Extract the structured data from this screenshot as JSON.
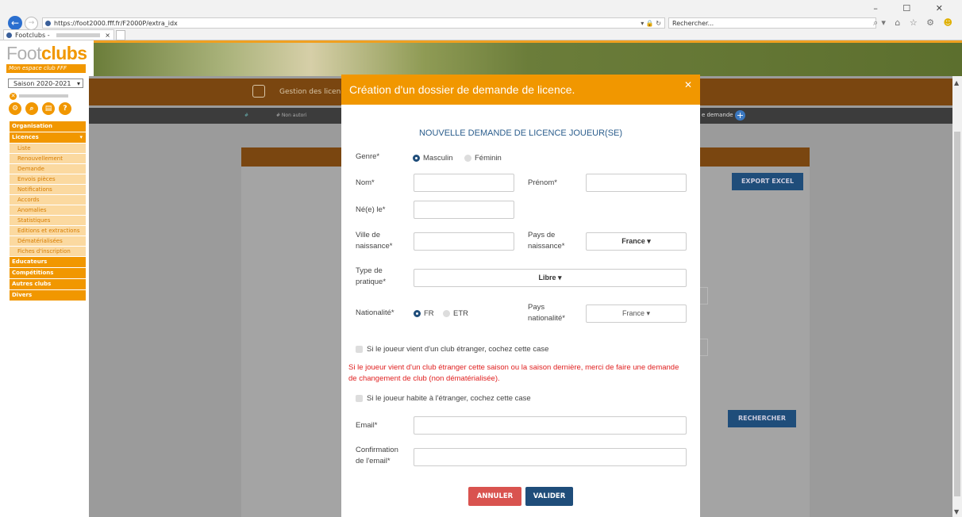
{
  "browser": {
    "url": "https://foot2000.fff.fr/F2000P/extra_idx",
    "search_placeholder": "Rechercher...",
    "tab_title": "Footclubs -",
    "window_controls": "– ☐ ✕"
  },
  "site": {
    "logo_foot": "Foot",
    "logo_clubs": "clubs",
    "logo_sub": "Mon espace club FFF"
  },
  "sidebar": {
    "season": "Saison 2020-2021",
    "menu": [
      {
        "label": "Organisation"
      },
      {
        "label": "Licences"
      }
    ],
    "licences_sub": [
      "Liste",
      "Renouvellement",
      "Demande",
      "Envois pièces",
      "Notifications",
      "Accords",
      "Anomalies",
      "Statistiques",
      "Editions et extractions",
      "Dématérialisées",
      "Fiches d'inscription"
    ],
    "menu_after": [
      "Educateurs",
      "Compétitions",
      "Autres clubs",
      "Divers"
    ]
  },
  "main": {
    "title": "Gestion des licen",
    "nav_item": "# Non autori",
    "nav_right": "e demande",
    "export_label": "EXPORT EXCEL",
    "search_label": "RECHERCHER"
  },
  "modal": {
    "title": "Création d'un dossier de demande de licence.",
    "subtitle": "NOUVELLE DEMANDE DE LICENCE JOUEUR(SE)",
    "genre_label": "Genre*",
    "genre_male": "Masculin",
    "genre_female": "Féminin",
    "nom_label": "Nom*",
    "prenom_label": "Prénom*",
    "ne_label": "Né(e) le*",
    "ville_label_1": "Ville de",
    "ville_label_2": "naissance*",
    "pays_label_1": "Pays de",
    "pays_label_2": "naissance*",
    "pays_value": "France",
    "type_label_1": "Type de",
    "type_label_2": "pratique*",
    "type_value": "Libre",
    "nat_label": "Nationalité*",
    "nat_fr": "FR",
    "nat_etr": "ETR",
    "pays_nat_label_1": "Pays",
    "pays_nat_label_2": "nationalité*",
    "pays_nat_value": "France",
    "check_club": "Si le joueur vient d'un club étranger, cochez cette case",
    "warning": "Si le joueur vient d'un club étranger cette saison ou la saison dernière, merci de faire une demande de changement de club (non dématérialisée).",
    "check_abroad": "Si le joueur habite à l'étranger, cochez cette case",
    "email_label": "Email*",
    "confirm_label_1": "Confirmation",
    "confirm_label_2": "de l'email*",
    "cancel": "ANNULER",
    "submit": "VALIDER"
  },
  "colors": {
    "accent": "#f19700",
    "primary": "#1f4d7a",
    "danger": "#d9534f",
    "warning_text": "#e02020"
  }
}
